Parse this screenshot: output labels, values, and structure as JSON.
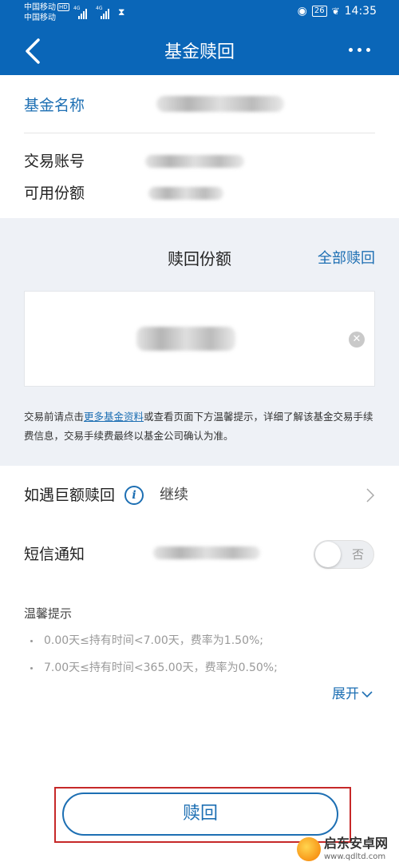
{
  "status_bar": {
    "carrier1": "中国移动",
    "carrier1_badge": "HD",
    "carrier2": "中国移动",
    "network1": "4G",
    "network2": "4G",
    "battery": "26",
    "time": "14:35"
  },
  "header": {
    "title": "基金赎回"
  },
  "fund": {
    "name_label": "基金名称",
    "account_label": "交易账号",
    "shares_label": "可用份额"
  },
  "redeem": {
    "title": "赎回份额",
    "redeem_all": "全部赎回",
    "notice_prefix": "交易前请点击",
    "notice_link": "更多基金资料",
    "notice_suffix": "或查看页面下方温馨提示，详细了解该基金交易手续费信息，交易手续费最终以基金公司确认为准。"
  },
  "options": {
    "large_redeem_label": "如遇巨额赎回",
    "large_redeem_value": "继续",
    "sms_label": "短信通知",
    "sms_toggle_text": "否"
  },
  "tips": {
    "title": "温馨提示",
    "items": [
      "0.00天≤持有时间<7.00天，费率为1.50%;",
      "7.00天≤持有时间<365.00天，费率为0.50%;"
    ],
    "expand": "展开"
  },
  "submit": {
    "label": "赎回"
  },
  "watermark": {
    "name": "启东安卓网",
    "url": "www.qdltd.com"
  }
}
